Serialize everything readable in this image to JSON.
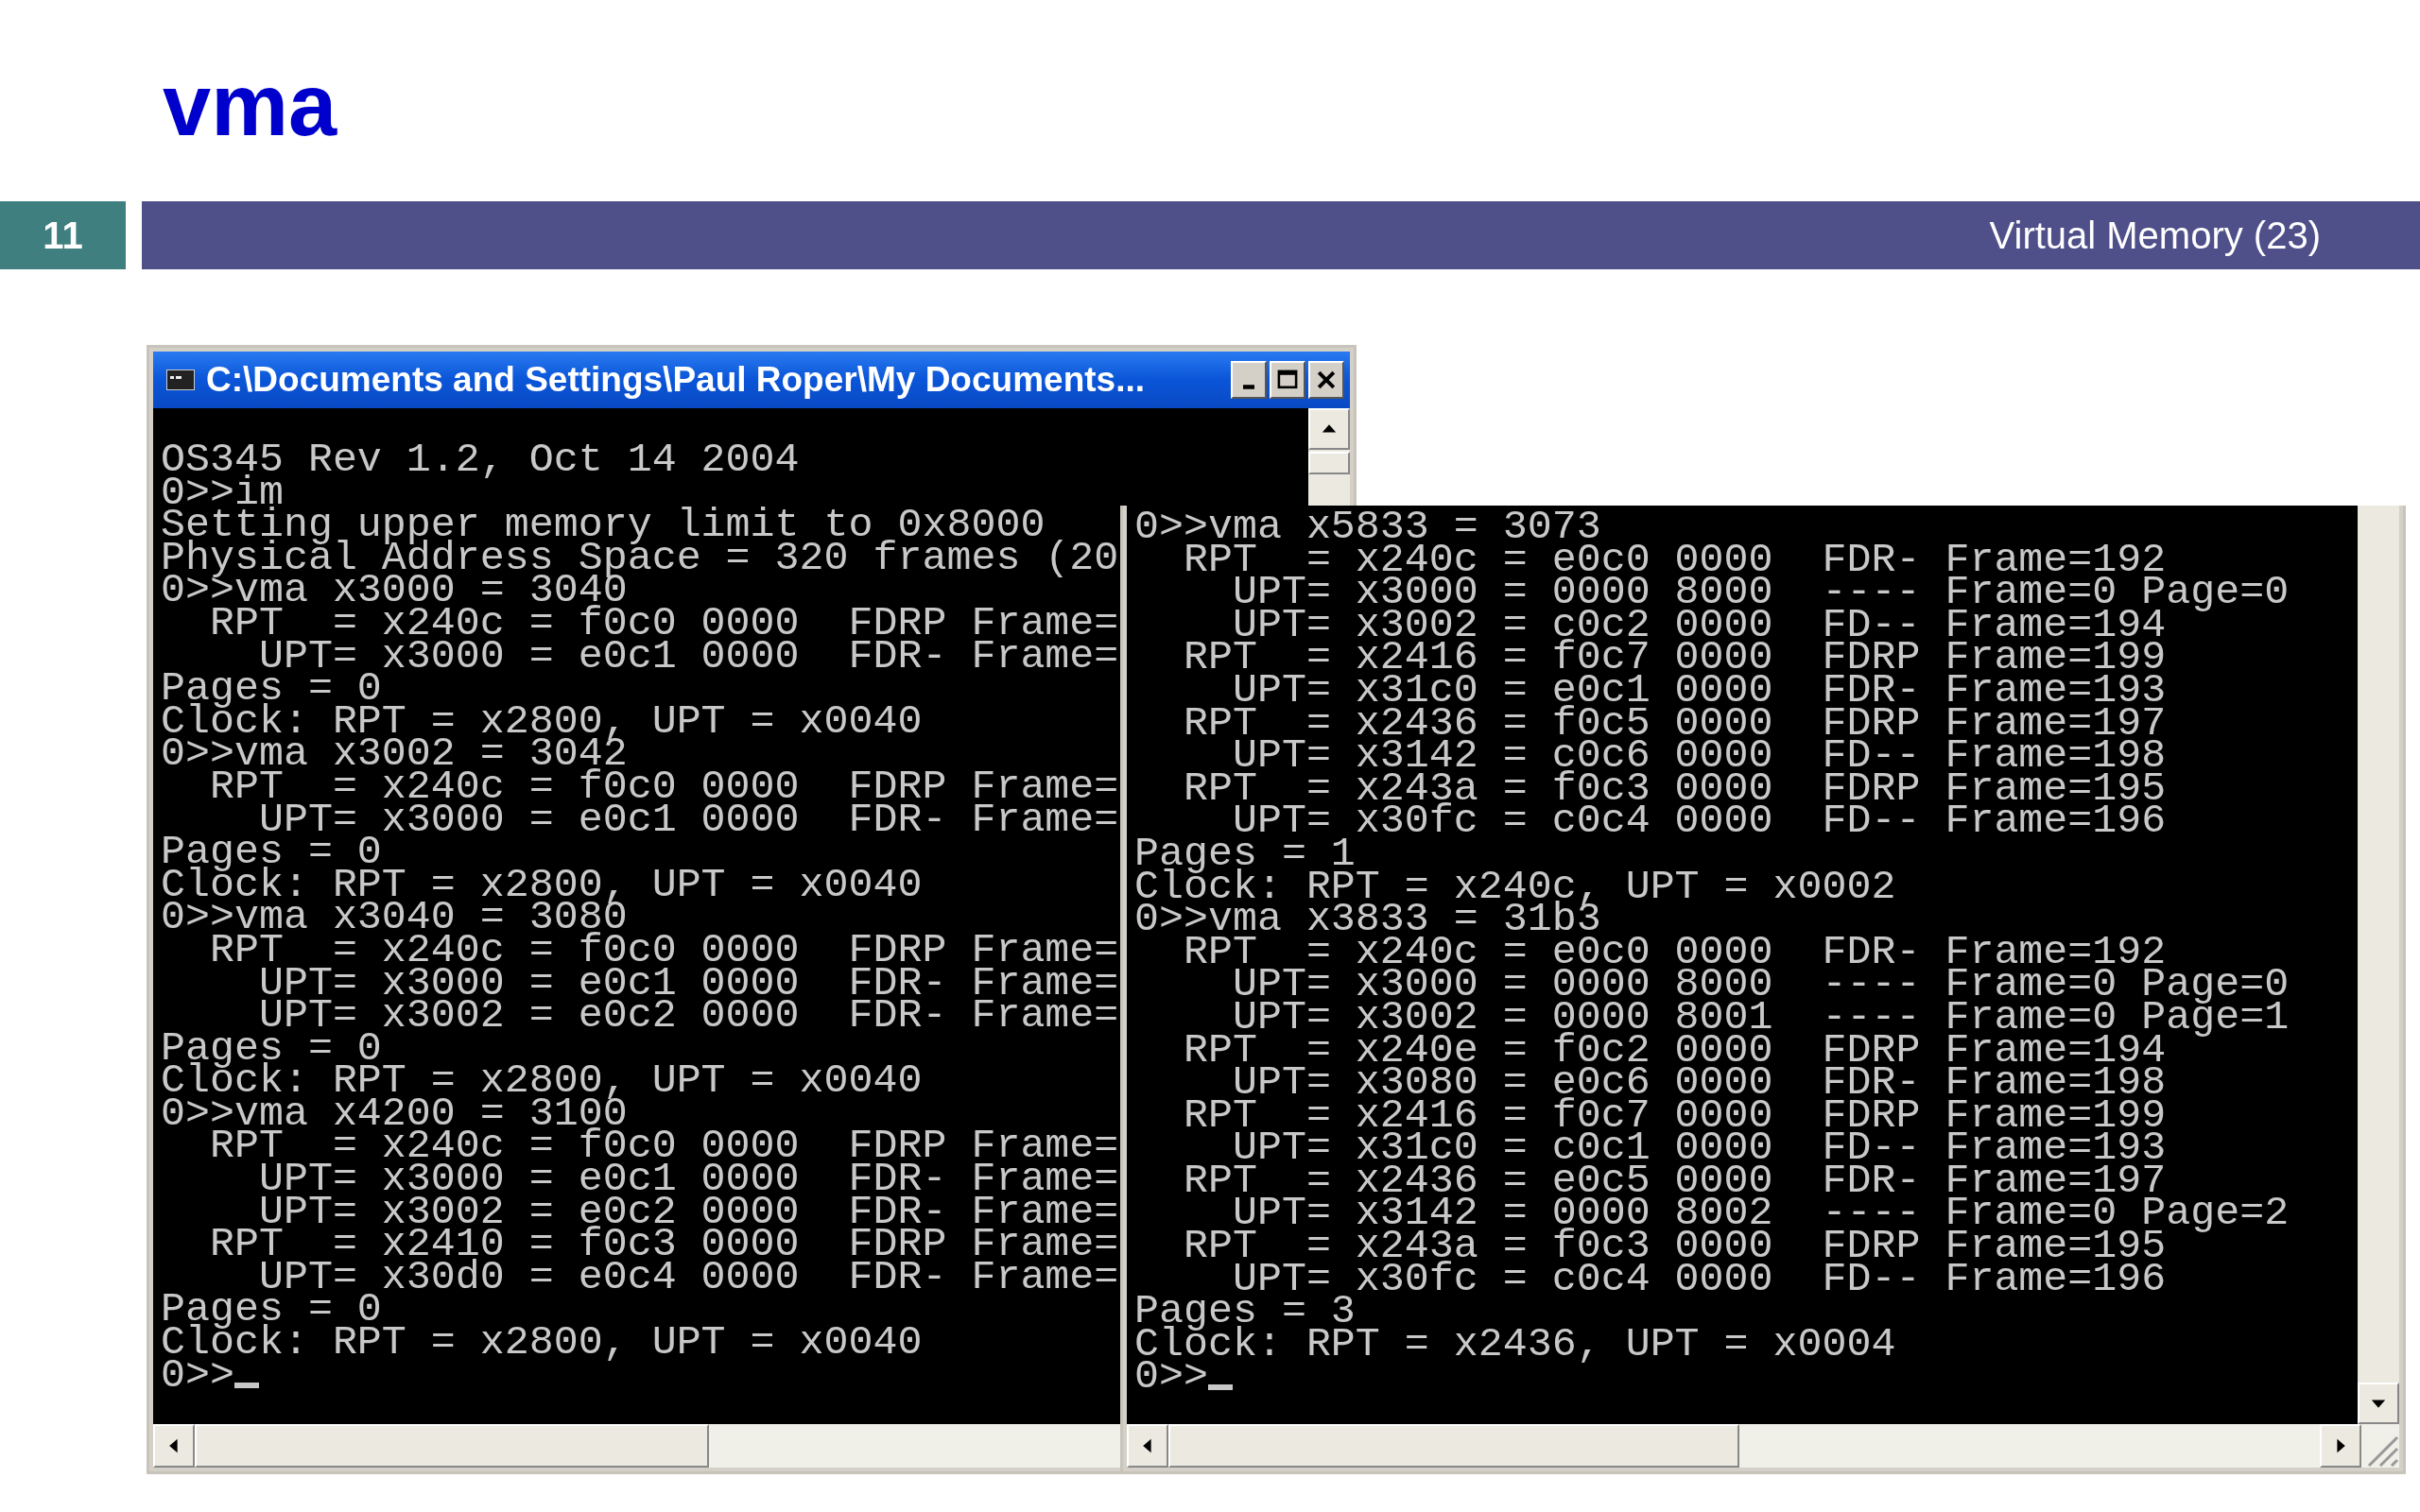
{
  "slide": {
    "title": "vma",
    "number": "11",
    "section": "Virtual Memory (23)"
  },
  "windows": [
    {
      "title": "C:\\Documents and Settings\\Paul Roper\\My Documents...",
      "cursor": true,
      "lines": [
        "OS345 Rev 1.2, Oct 14 2004",
        "0>>im",
        "Setting upper memory limit to 0x8000",
        "Physical Address Space = 320 frames (20",
        "0>>vma x3000 = 3040",
        "  RPT  = x240c = f0c0 0000  FDRP Frame=",
        "    UPT= x3000 = e0c1 0000  FDR- Frame=",
        "Pages = 0",
        "Clock: RPT = x2800, UPT = x0040",
        "0>>vma x3002 = 3042",
        "  RPT  = x240c = f0c0 0000  FDRP Frame=",
        "    UPT= x3000 = e0c1 0000  FDR- Frame=",
        "Pages = 0",
        "Clock: RPT = x2800, UPT = x0040",
        "0>>vma x3040 = 3080",
        "  RPT  = x240c = f0c0 0000  FDRP Frame=",
        "    UPT= x3000 = e0c1 0000  FDR- Frame=",
        "    UPT= x3002 = e0c2 0000  FDR- Frame=",
        "Pages = 0",
        "Clock: RPT = x2800, UPT = x0040",
        "0>>vma x4200 = 3100",
        "  RPT  = x240c = f0c0 0000  FDRP Frame=",
        "    UPT= x3000 = e0c1 0000  FDR- Frame=",
        "    UPT= x3002 = e0c2 0000  FDR- Frame=",
        "  RPT  = x2410 = f0c3 0000  FDRP Frame=",
        "    UPT= x30d0 = e0c4 0000  FDR- Frame=",
        "Pages = 0",
        "Clock: RPT = x2800, UPT = x0040",
        "0>>"
      ]
    },
    {
      "cursor": true,
      "lines": [
        "0>>vma x5833 = 3073",
        "  RPT  = x240c = e0c0 0000  FDR- Frame=192",
        "    UPT= x3000 = 0000 8000  ---- Frame=0 Page=0",
        "    UPT= x3002 = c0c2 0000  FD-- Frame=194",
        "  RPT  = x2416 = f0c7 0000  FDRP Frame=199",
        "    UPT= x31c0 = e0c1 0000  FDR- Frame=193",
        "  RPT  = x2436 = f0c5 0000  FDRP Frame=197",
        "    UPT= x3142 = c0c6 0000  FD-- Frame=198",
        "  RPT  = x243a = f0c3 0000  FDRP Frame=195",
        "    UPT= x30fc = c0c4 0000  FD-- Frame=196",
        "Pages = 1",
        "Clock: RPT = x240c, UPT = x0002",
        "0>>vma x3833 = 31b3",
        "  RPT  = x240c = e0c0 0000  FDR- Frame=192",
        "    UPT= x3000 = 0000 8000  ---- Frame=0 Page=0",
        "    UPT= x3002 = 0000 8001  ---- Frame=0 Page=1",
        "  RPT  = x240e = f0c2 0000  FDRP Frame=194",
        "    UPT= x3080 = e0c6 0000  FDR- Frame=198",
        "  RPT  = x2416 = f0c7 0000  FDRP Frame=199",
        "    UPT= x31c0 = c0c1 0000  FD-- Frame=193",
        "  RPT  = x2436 = e0c5 0000  FDR- Frame=197",
        "    UPT= x3142 = 0000 8002  ---- Frame=0 Page=2",
        "  RPT  = x243a = f0c3 0000  FDRP Frame=195",
        "    UPT= x30fc = c0c4 0000  FD-- Frame=196",
        "Pages = 3",
        "Clock: RPT = x2436, UPT = x0004",
        "0>>"
      ]
    }
  ]
}
